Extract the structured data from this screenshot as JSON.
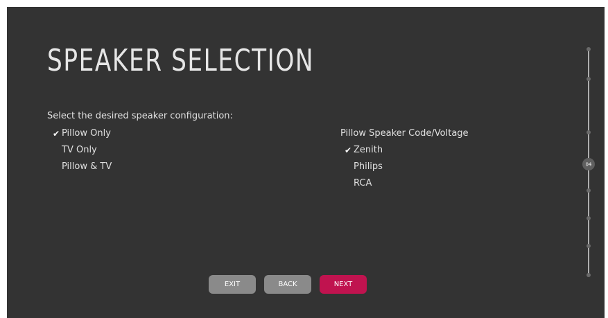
{
  "page": {
    "title": "SPEAKER SELECTION",
    "prompt": "Select the desired speaker configuration:"
  },
  "speaker_config": {
    "options": [
      {
        "label": "Pillow Only",
        "selected": true
      },
      {
        "label": "TV Only",
        "selected": false
      },
      {
        "label": "Pillow & TV",
        "selected": false
      }
    ]
  },
  "pillow_code": {
    "heading": "Pillow Speaker Code/Voltage",
    "options": [
      {
        "label": "Zenith",
        "selected": true
      },
      {
        "label": "Philips",
        "selected": false
      },
      {
        "label": "RCA",
        "selected": false
      }
    ]
  },
  "buttons": {
    "exit": "EXIT",
    "back": "BACK",
    "next": "NEXT"
  },
  "progress": {
    "current_step": "04",
    "current_index": 3,
    "total_steps": 9
  },
  "colors": {
    "background": "#333333",
    "accent": "#c0134f",
    "button_grey": "#8a8a8a"
  },
  "icons": {
    "selected_marker": "checkmark-icon"
  }
}
